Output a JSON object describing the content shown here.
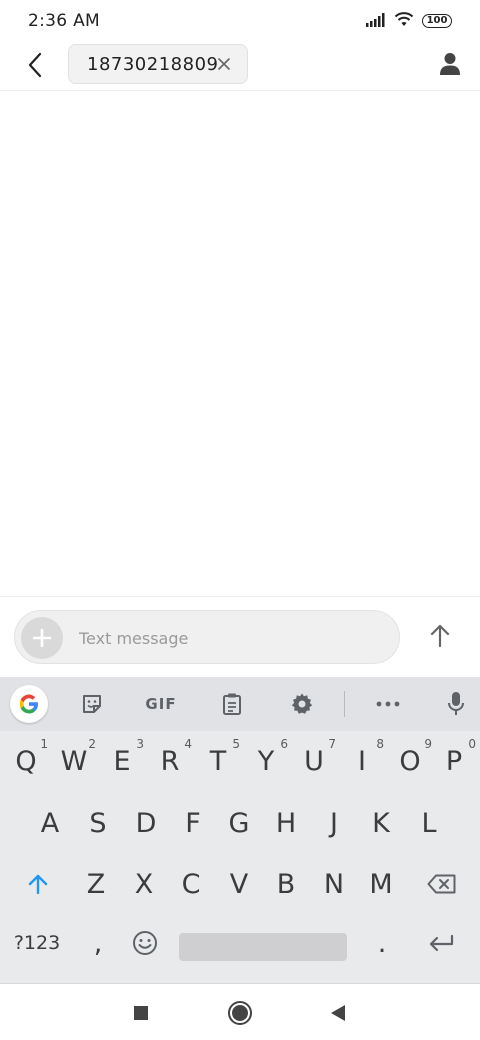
{
  "status_bar": {
    "time": "2:36 AM",
    "battery": "100"
  },
  "header": {
    "recipient": "18730218809"
  },
  "composer": {
    "placeholder": "Text message"
  },
  "keyboard": {
    "toolbar": {
      "gif_label": "GIF"
    },
    "row1": [
      {
        "key": "Q",
        "hint": "1"
      },
      {
        "key": "W",
        "hint": "2"
      },
      {
        "key": "E",
        "hint": "3"
      },
      {
        "key": "R",
        "hint": "4"
      },
      {
        "key": "T",
        "hint": "5"
      },
      {
        "key": "Y",
        "hint": "6"
      },
      {
        "key": "U",
        "hint": "7"
      },
      {
        "key": "I",
        "hint": "8"
      },
      {
        "key": "O",
        "hint": "9"
      },
      {
        "key": "P",
        "hint": "0"
      }
    ],
    "row2": [
      "A",
      "S",
      "D",
      "F",
      "G",
      "H",
      "J",
      "K",
      "L"
    ],
    "row3": [
      "Z",
      "X",
      "C",
      "V",
      "B",
      "N",
      "M"
    ],
    "row4": {
      "symbols": "?123",
      "comma": ",",
      "period": "."
    }
  },
  "colors": {
    "accent_blue": "#2196f3",
    "keyboard_bg": "#e9eaec",
    "toolbar_bg": "#e1e2e5"
  }
}
